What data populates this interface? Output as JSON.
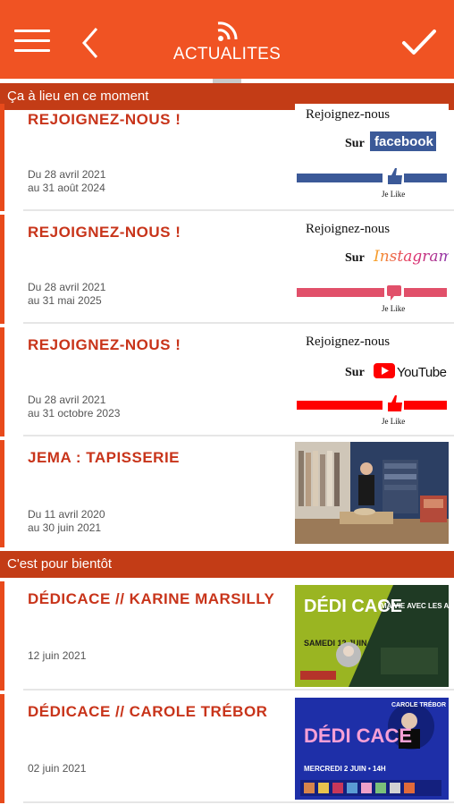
{
  "header": {
    "title": "ACTUALITES",
    "menu_icon": "hamburger-menu-icon",
    "back_icon": "chevron-left-icon",
    "rss_icon": "rss-icon",
    "check_icon": "checkmark-icon",
    "color": "#f05323"
  },
  "sections": [
    {
      "label": "Ça à lieu en ce moment",
      "items": [
        {
          "title": "REJOIGNEZ-NOUS !",
          "date_line1": "Du 28 avril 2021",
          "date_line2": "au 31 août 2024",
          "image": {
            "heading": "Rejoignez-nous",
            "sur": "Sur",
            "brand": "facebook",
            "like": "Je Like",
            "color": "#3b5998"
          }
        },
        {
          "title": "REJOIGNEZ-NOUS !",
          "date_line1": "Du 28 avril 2021",
          "date_line2": "au 31 mai 2025",
          "image": {
            "heading": "Rejoignez-nous",
            "sur": "Sur",
            "brand": "Instagram",
            "like": "Je Like",
            "color": "#e1506a"
          }
        },
        {
          "title": "REJOIGNEZ-NOUS !",
          "date_line1": "Du 28 avril 2021",
          "date_line2": "au 31 octobre 2023",
          "image": {
            "heading": "Rejoignez-nous",
            "sur": "Sur",
            "brand": "YouTube",
            "like": "Je Like",
            "color": "#ff0000"
          }
        },
        {
          "title": "JEMA : TAPISSERIE",
          "date_line1": "Du 11 avril 2020",
          "date_line2": "au 30 juin 2021",
          "image": {
            "kind": "photo-atelier-tapisserie"
          }
        }
      ]
    },
    {
      "label": "C'est pour bientôt",
      "items": [
        {
          "title": "DÉDICACE // KARINE MARSILLY",
          "date_line1": "12 juin 2021",
          "image": {
            "kind": "poster-dedicace",
            "big": "DÉDI CACE",
            "day": "SAMEDI 12 JUIN",
            "book": "MA VIE AVEC LES ARBRES",
            "bg": "#9ab522"
          }
        },
        {
          "title": "DÉDICACE // CAROLE TRÉBOR",
          "date_line1": "02 juin 2021",
          "image": {
            "kind": "poster-dedicace",
            "big": "DÉDI CACE",
            "day": "MERCREDI 2 JUIN • 14H",
            "author": "CAROLE TRÉBOR",
            "bg": "#1e2fa8"
          }
        }
      ]
    }
  ]
}
